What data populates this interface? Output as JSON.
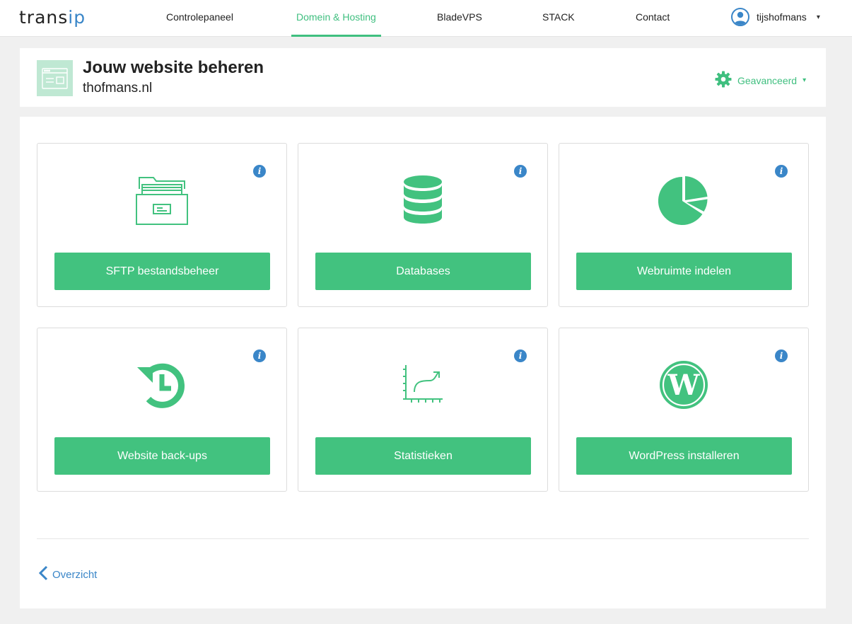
{
  "brand": {
    "logo_left": "trans",
    "logo_right": "ip"
  },
  "nav": {
    "items": [
      {
        "label": "Controlepaneel",
        "active": false
      },
      {
        "label": "Domein & Hosting",
        "active": true
      },
      {
        "label": "BladeVPS",
        "active": false
      },
      {
        "label": "STACK",
        "active": false
      },
      {
        "label": "Contact",
        "active": false
      }
    ],
    "user": {
      "name": "tijshofmans",
      "caret": "▾"
    }
  },
  "header": {
    "title": "Jouw website beheren",
    "subtitle": "thofmans.nl",
    "advanced_label": "Geavanceerd",
    "caret": "▾"
  },
  "tiles": [
    {
      "label": "SFTP bestandsbeheer",
      "icon": "folder-icon",
      "info": "i"
    },
    {
      "label": "Databases",
      "icon": "database-icon",
      "info": "i"
    },
    {
      "label": "Webruimte indelen",
      "icon": "pie-chart-icon",
      "info": "i"
    },
    {
      "label": "Website back-ups",
      "icon": "history-icon",
      "info": "i"
    },
    {
      "label": "Statistieken",
      "icon": "line-chart-icon",
      "info": "i"
    },
    {
      "label": "WordPress installeren",
      "icon": "wordpress-icon",
      "info": "i"
    }
  ],
  "footer": {
    "back_label": "Overzicht",
    "back_icon": "chevron-left-icon"
  },
  "colors": {
    "accent_green": "#42c27f",
    "link_blue": "#3a86c8",
    "icon_bg": "#bfe8d3",
    "page_bg": "#f0f0f0"
  }
}
